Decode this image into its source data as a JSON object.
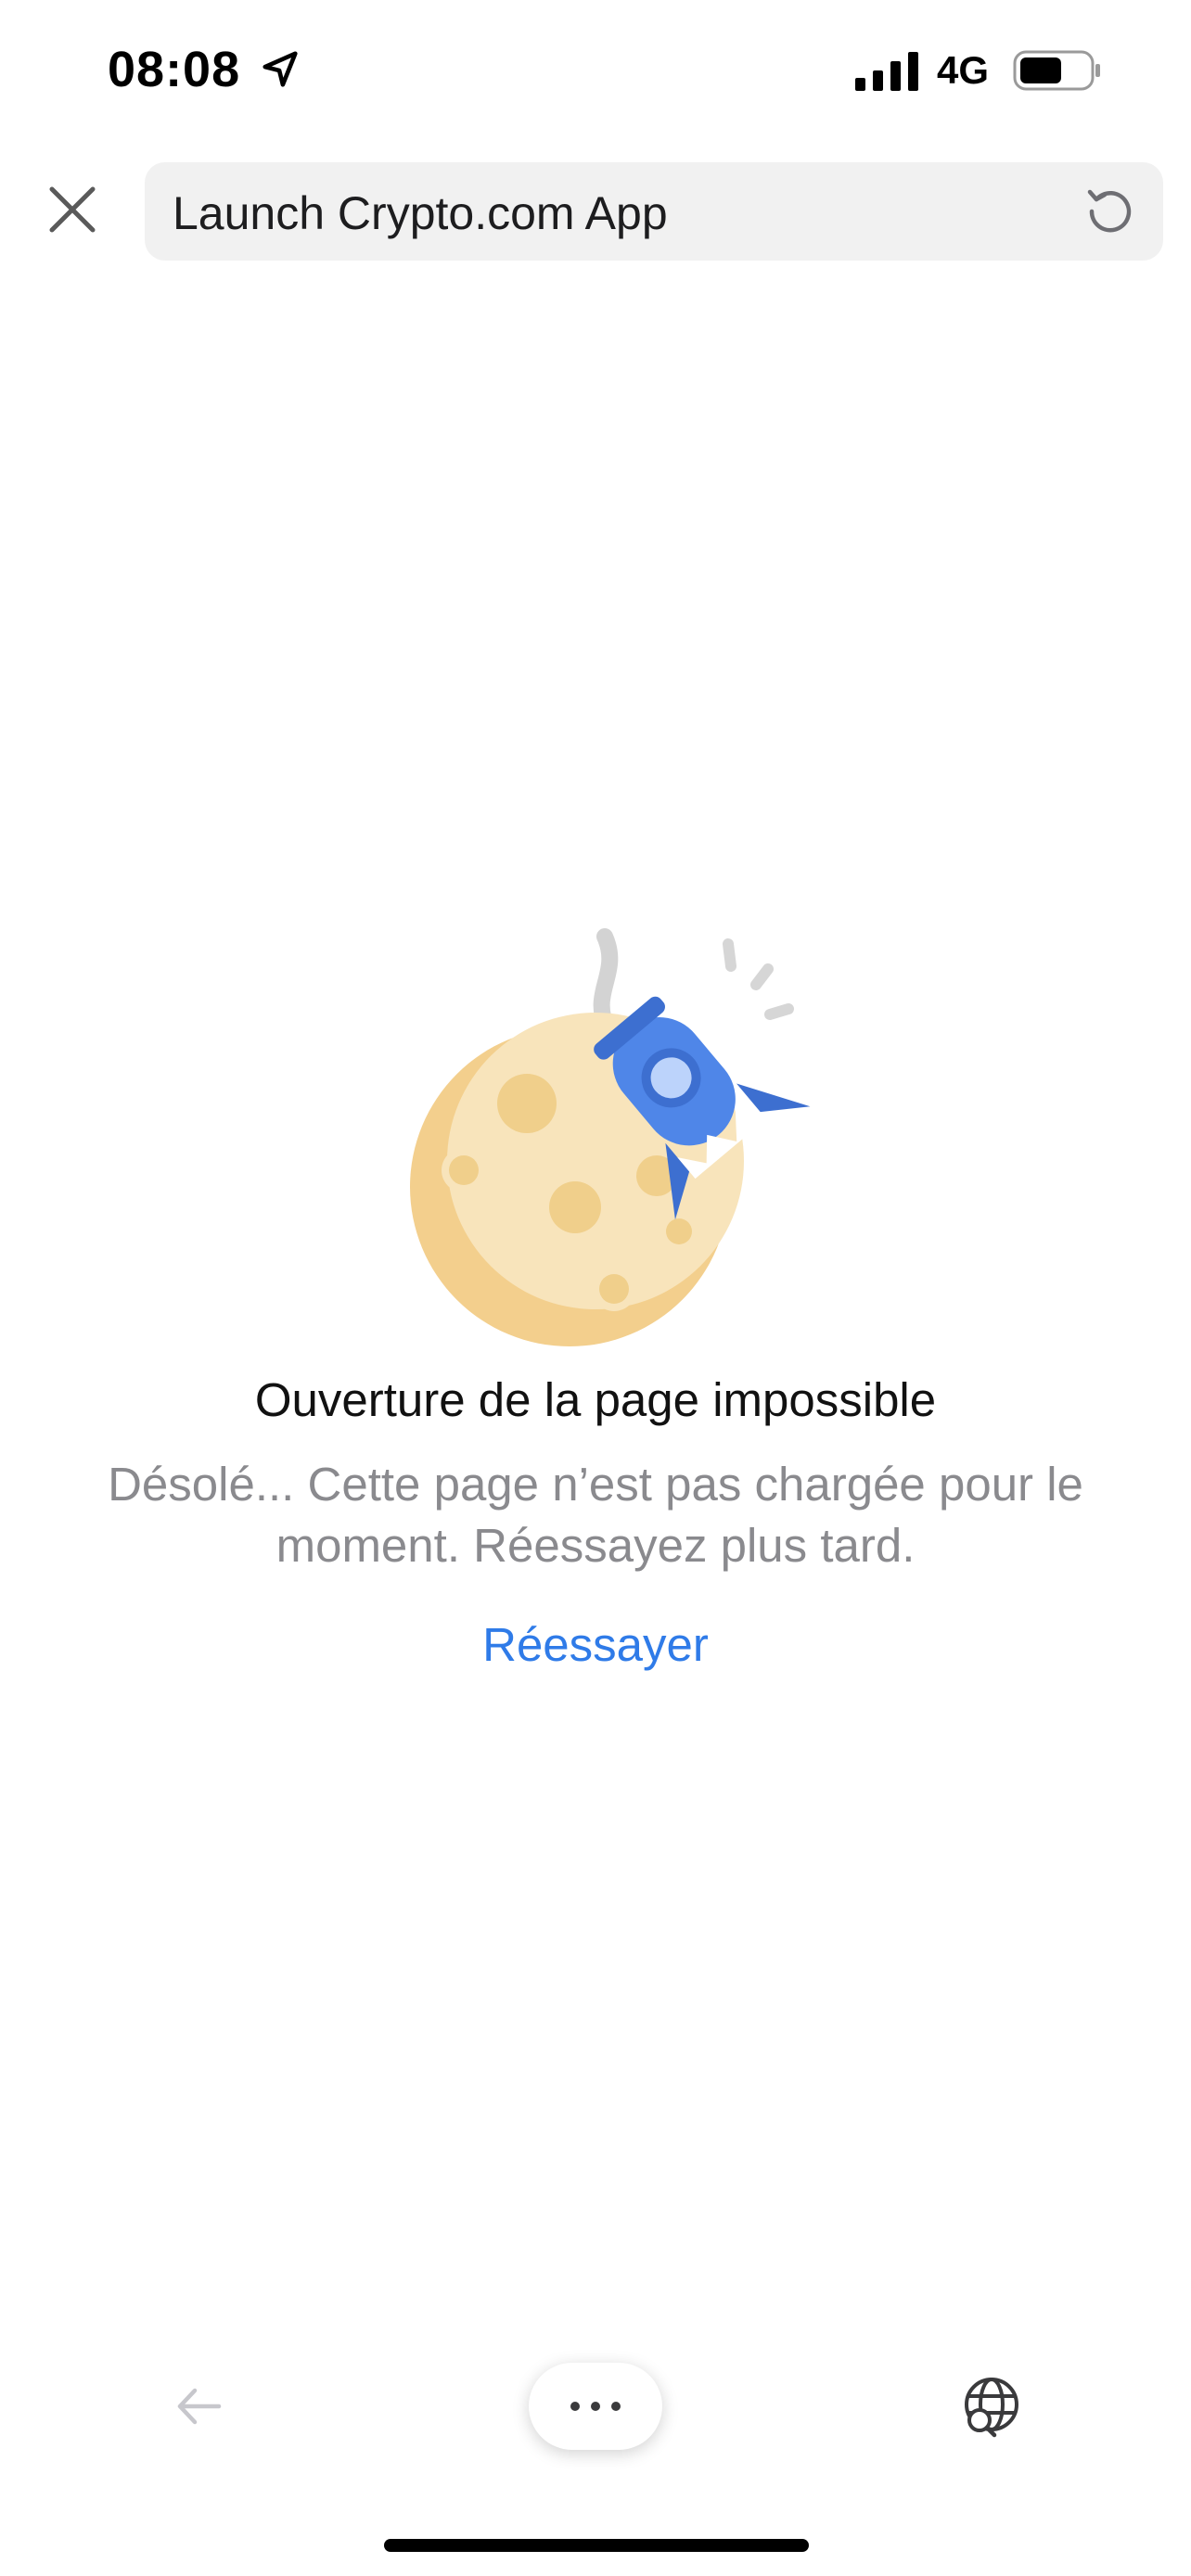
{
  "status_bar": {
    "time": "08:08",
    "network": "4G",
    "icons": [
      "location-arrow-icon",
      "signal-icon",
      "battery-icon"
    ]
  },
  "top_bar": {
    "url_title": "Launch Crypto.com App",
    "icons": [
      "close-icon",
      "reload-icon"
    ]
  },
  "error": {
    "title": "Ouverture de la page impossible",
    "message": "Désolé... Cette page n’est pas chargée pour le moment. Réessayez plus tard.",
    "retry_label": "Réessayer"
  },
  "bottom_bar": {
    "icons": [
      "back-arrow-icon",
      "more-dots-icon",
      "globe-search-icon"
    ]
  },
  "colors": {
    "accent": "#2f7be8",
    "moon": "#f6dca6",
    "rocket": "#4f86e8",
    "muted_text": "#8a8a8e",
    "url_field_bg": "#f1f1f1"
  }
}
